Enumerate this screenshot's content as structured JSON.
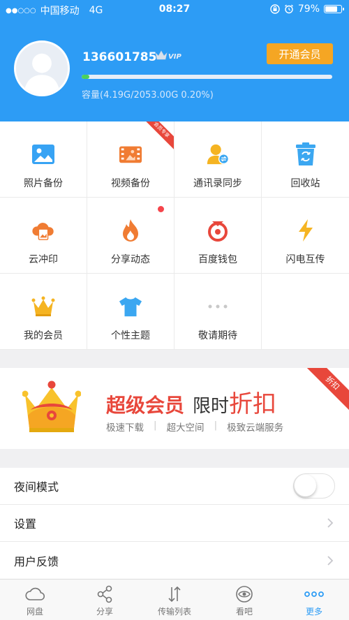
{
  "status_bar": {
    "carrier": "中国移动",
    "network": "4G",
    "time": "08:27",
    "battery_percent": "79%",
    "battery_level": 0.79
  },
  "profile": {
    "username": "136601785",
    "vip_badge": "VIP",
    "open_member_label": "开通会员",
    "storage_used_fraction": 0.002,
    "capacity_text": "容量(4.19G/2053.00G 0.20%)"
  },
  "grid": {
    "items": [
      {
        "label": "照片备份",
        "icon": "photo-icon",
        "color": "#37a3f4"
      },
      {
        "label": "视频备份",
        "icon": "video-icon",
        "color": "#f07c33",
        "ribbon": "会员专享"
      },
      {
        "label": "通讯录同步",
        "icon": "contacts-icon",
        "color": "#f5b422"
      },
      {
        "label": "回收站",
        "icon": "recycle-icon",
        "color": "#3ba7f1"
      },
      {
        "label": "云冲印",
        "icon": "cloud-print-icon",
        "color": "#f07c33"
      },
      {
        "label": "分享动态",
        "icon": "flame-icon",
        "color": "#f07c33",
        "has_dot": true
      },
      {
        "label": "百度钱包",
        "icon": "wallet-icon",
        "color": "#e8473b"
      },
      {
        "label": "闪电互传",
        "icon": "lightning-icon",
        "color": "#f5b422"
      },
      {
        "label": "我的会员",
        "icon": "crown-icon",
        "color": "#f5b422"
      },
      {
        "label": "个性主题",
        "icon": "tshirt-icon",
        "color": "#3ba7f1"
      },
      {
        "label": "敬请期待",
        "icon": "more-dots-icon",
        "color": "#c8c8c8"
      }
    ]
  },
  "promo": {
    "title_a": "超级会员",
    "title_b": "限时",
    "title_c": "折扣",
    "features": [
      "极速下载",
      "超大空间",
      "极致云端服务"
    ],
    "ribbon": "折扣"
  },
  "settings": {
    "night_mode_label": "夜间模式",
    "night_mode_on": false,
    "settings_label": "设置",
    "feedback_label": "用户反馈"
  },
  "tabs": [
    {
      "label": "网盘",
      "icon": "cloud-icon"
    },
    {
      "label": "分享",
      "icon": "share-icon"
    },
    {
      "label": "传输列表",
      "icon": "transfer-icon"
    },
    {
      "label": "看吧",
      "icon": "eye-icon"
    },
    {
      "label": "更多",
      "icon": "more-icon",
      "active": true
    }
  ],
  "colors": {
    "brand_blue": "#2d9cf5",
    "accent_orange": "#f5a623",
    "promo_red": "#e8473b",
    "progress_green": "#4ad15c"
  }
}
